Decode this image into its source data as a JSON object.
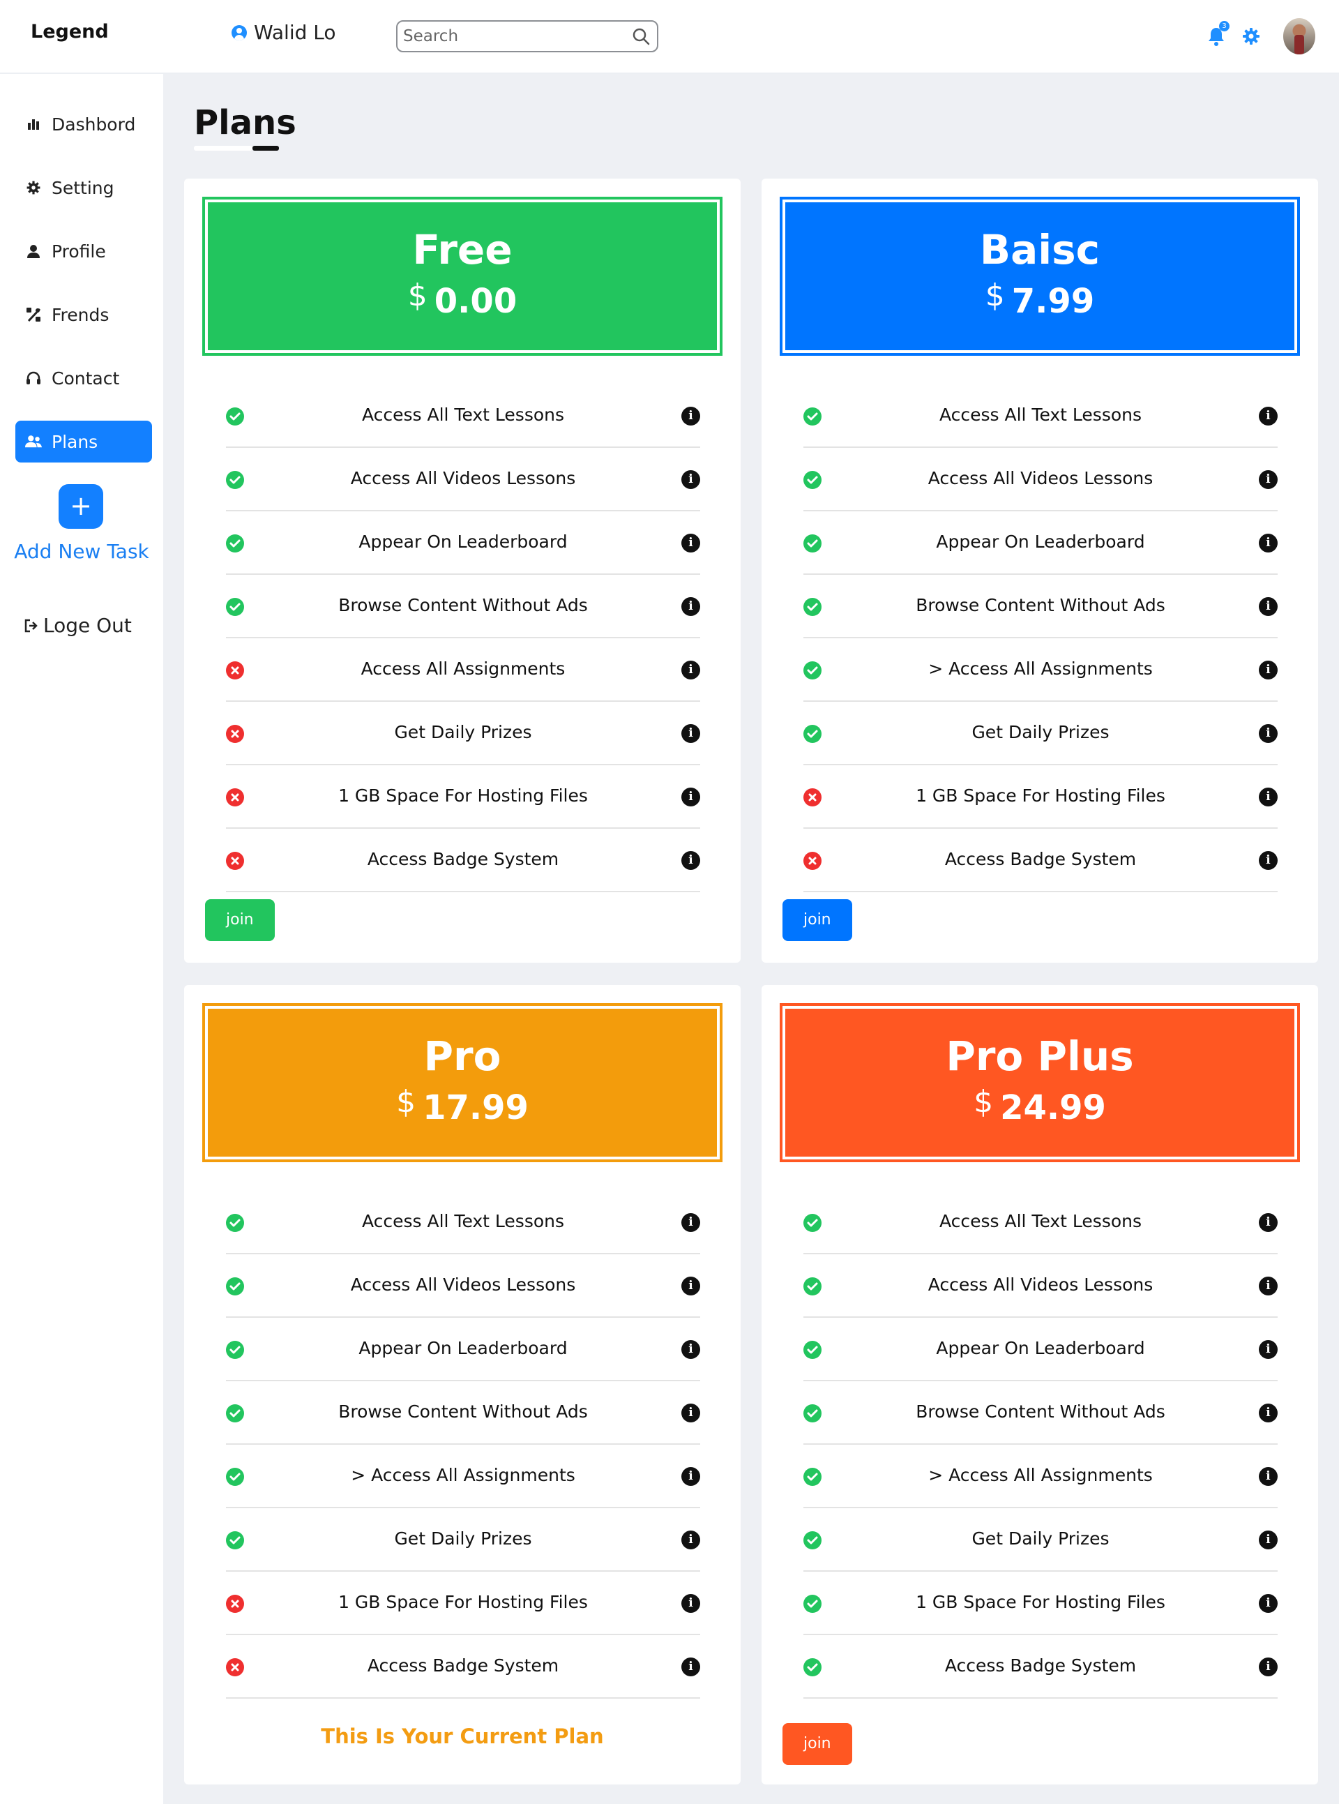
{
  "header": {
    "brand": "Legend",
    "user_name": "Walid Lo",
    "search_placeholder": "Search",
    "notification_count": "3"
  },
  "sidebar": {
    "items": [
      {
        "label": "Dashbord",
        "icon": "bar-chart-icon"
      },
      {
        "label": "Setting",
        "icon": "gear-icon"
      },
      {
        "label": "Profile",
        "icon": "user-icon"
      },
      {
        "label": "Frends",
        "icon": "diagram-icon"
      },
      {
        "label": "Contact",
        "icon": "headset-icon"
      },
      {
        "label": "Plans",
        "icon": "users-icon",
        "active": true
      }
    ],
    "add_task_label": "Add New Task",
    "add_task_icon": "plus-icon",
    "logout_label": "Loge Out",
    "logout_icon": "sign-out-icon"
  },
  "page": {
    "title": "Plans"
  },
  "plans": [
    {
      "name": "Free",
      "currency": "$",
      "price": "0.00",
      "color": "#22c55e",
      "features": [
        {
          "text": "Access All Text Lessons",
          "included": true
        },
        {
          "text": "Access All Videos Lessons",
          "included": true
        },
        {
          "text": "Appear On Leaderboard",
          "included": true
        },
        {
          "text": "Browse Content Without Ads",
          "included": true
        },
        {
          "text": "Access All Assignments",
          "included": false
        },
        {
          "text": "Get Daily Prizes",
          "included": false
        },
        {
          "text": "1 GB Space For Hosting Files",
          "included": false
        },
        {
          "text": "Access Badge System",
          "included": false
        }
      ],
      "button_label": "join"
    },
    {
      "name": "Baisc",
      "currency": "$",
      "price": "7.99",
      "color": "#0075ff",
      "features": [
        {
          "text": "Access All Text Lessons",
          "included": true
        },
        {
          "text": "Access All Videos Lessons",
          "included": true
        },
        {
          "text": "Appear On Leaderboard",
          "included": true
        },
        {
          "text": "Browse Content Without Ads",
          "included": true
        },
        {
          "text": "> Access All Assignments",
          "included": true
        },
        {
          "text": "Get Daily Prizes",
          "included": true
        },
        {
          "text": "1 GB Space For Hosting Files",
          "included": false
        },
        {
          "text": "Access Badge System",
          "included": false
        }
      ],
      "button_label": "join"
    },
    {
      "name": "Pro",
      "currency": "$",
      "price": "17.99",
      "color": "#f39c0c",
      "features": [
        {
          "text": "Access All Text Lessons",
          "included": true
        },
        {
          "text": "Access All Videos Lessons",
          "included": true
        },
        {
          "text": "Appear On Leaderboard",
          "included": true
        },
        {
          "text": "Browse Content Without Ads",
          "included": true
        },
        {
          "text": "> Access All Assignments",
          "included": true
        },
        {
          "text": "Get Daily Prizes",
          "included": true
        },
        {
          "text": "1 GB Space For Hosting Files",
          "included": false
        },
        {
          "text": "Access Badge System",
          "included": false
        }
      ],
      "current_plan_label": "This Is Your Current Plan"
    },
    {
      "name": "Pro Plus",
      "currency": "$",
      "price": "24.99",
      "color": "#ff5722",
      "features": [
        {
          "text": "Access All Text Lessons",
          "included": true
        },
        {
          "text": "Access All Videos Lessons",
          "included": true
        },
        {
          "text": "Appear On Leaderboard",
          "included": true
        },
        {
          "text": "Browse Content Without Ads",
          "included": true
        },
        {
          "text": "> Access All Assignments",
          "included": true
        },
        {
          "text": "Get Daily Prizes",
          "included": true
        },
        {
          "text": "1 GB Space For Hosting Files",
          "included": true
        },
        {
          "text": "Access Badge System",
          "included": true
        }
      ],
      "button_label": "join"
    }
  ]
}
